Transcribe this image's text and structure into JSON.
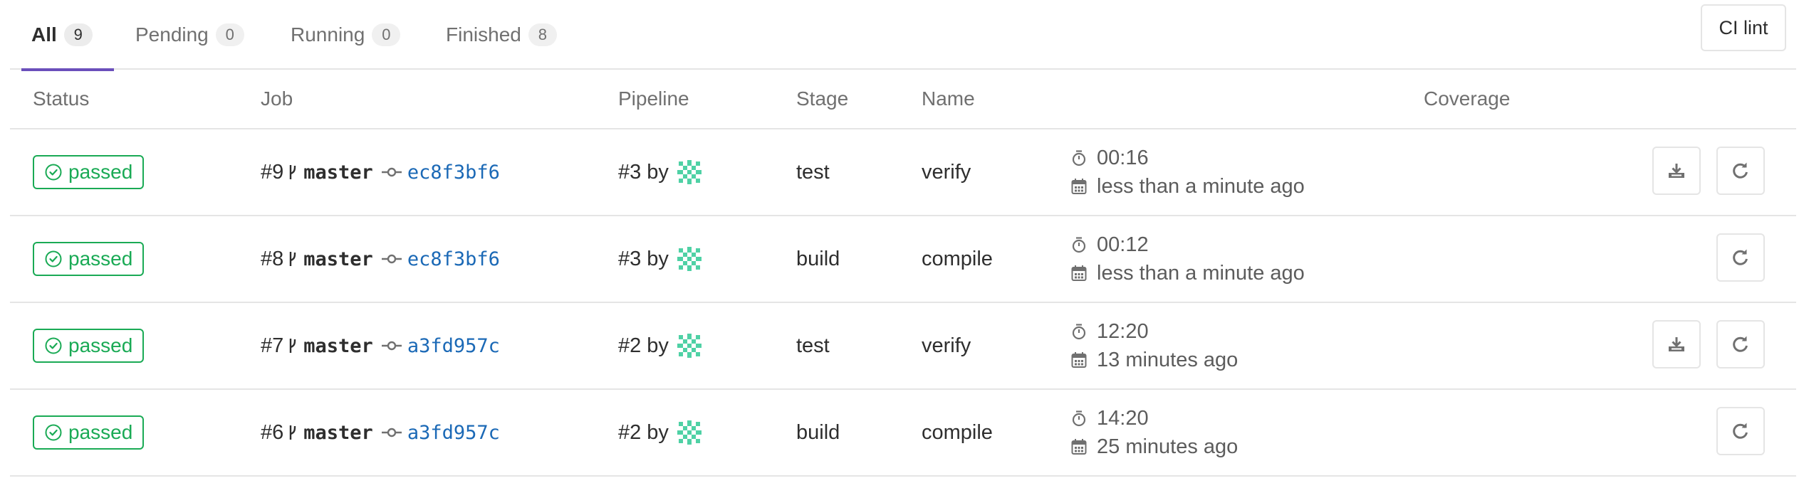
{
  "tabs": [
    {
      "label": "All",
      "count": "9"
    },
    {
      "label": "Pending",
      "count": "0"
    },
    {
      "label": "Running",
      "count": "0"
    },
    {
      "label": "Finished",
      "count": "8"
    }
  ],
  "ci_lint_label": "CI lint",
  "columns": {
    "status": "Status",
    "job": "Job",
    "pipeline": "Pipeline",
    "stage": "Stage",
    "name": "Name",
    "coverage": "Coverage"
  },
  "jobs": [
    {
      "status": "passed",
      "job_id": "#9",
      "ref": "master",
      "sha": "ec8f3bf6",
      "pipeline": "#3",
      "by": "by",
      "stage": "test",
      "name": "verify",
      "duration": "00:16",
      "finished": "less than a minute ago",
      "has_artifacts": true
    },
    {
      "status": "passed",
      "job_id": "#8",
      "ref": "master",
      "sha": "ec8f3bf6",
      "pipeline": "#3",
      "by": "by",
      "stage": "build",
      "name": "compile",
      "duration": "00:12",
      "finished": "less than a minute ago",
      "has_artifacts": false
    },
    {
      "status": "passed",
      "job_id": "#7",
      "ref": "master",
      "sha": "a3fd957c",
      "pipeline": "#2",
      "by": "by",
      "stage": "test",
      "name": "verify",
      "duration": "12:20",
      "finished": "13 minutes ago",
      "has_artifacts": true
    },
    {
      "status": "passed",
      "job_id": "#6",
      "ref": "master",
      "sha": "a3fd957c",
      "pipeline": "#2",
      "by": "by",
      "stage": "build",
      "name": "compile",
      "duration": "14:20",
      "finished": "25 minutes ago",
      "has_artifacts": false
    }
  ],
  "icons": {
    "status": "check-circle-icon",
    "branch": "branch-icon",
    "commit": "commit-icon",
    "timer": "timer-icon",
    "calendar": "calendar-icon",
    "download": "download-icon",
    "retry": "retry-icon",
    "avatar": "identicon-avatar"
  },
  "colors": {
    "success": "#1aaa55",
    "link": "#1b69b6",
    "active_tab": "#6b4fbb",
    "avatar": "#4fd1a5"
  }
}
